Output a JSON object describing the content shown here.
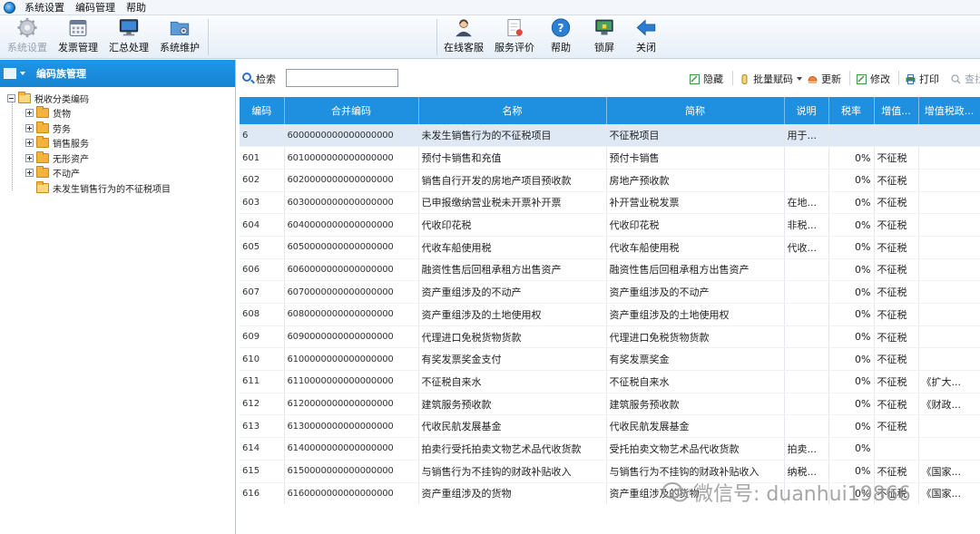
{
  "menubar": {
    "items": [
      "系统设置",
      "编码管理",
      "帮助"
    ]
  },
  "toolbar": {
    "left": [
      {
        "label": "系统设置",
        "icon": "gear-icon",
        "disabled": true
      },
      {
        "label": "发票管理",
        "icon": "calendar-icon",
        "disabled": false
      },
      {
        "label": "汇总处理",
        "icon": "monitor-icon",
        "disabled": false
      },
      {
        "label": "系统维护",
        "icon": "folder-gear-icon",
        "disabled": false
      }
    ],
    "right": [
      {
        "label": "在线客服",
        "icon": "support-agent-icon"
      },
      {
        "label": "服务评价",
        "icon": "evaluation-icon"
      },
      {
        "label": "帮助",
        "icon": "help-icon"
      },
      {
        "label": "锁屏",
        "icon": "lock-screen-icon"
      },
      {
        "label": "关闭",
        "icon": "close-arrow-icon"
      }
    ]
  },
  "left_panel": {
    "title": "编码族管理",
    "tree": {
      "root": "税收分类编码",
      "children": [
        "货物",
        "劳务",
        "销售服务",
        "无形资产",
        "不动产",
        "未发生销售行为的不征税项目"
      ]
    }
  },
  "search": {
    "label": "检索",
    "value": ""
  },
  "actions": [
    {
      "label": "隐藏",
      "icon": "edit-icon",
      "disabled": false
    },
    {
      "label": "批量赋码",
      "icon": "batch-code-icon",
      "disabled": false
    },
    {
      "label": "更新",
      "icon": "update-icon",
      "disabled": false
    },
    {
      "label": "修改",
      "icon": "modify-icon",
      "disabled": false
    },
    {
      "label": "打印",
      "icon": "print-icon",
      "disabled": false
    },
    {
      "label": "查找",
      "icon": "find-icon",
      "disabled": true
    }
  ],
  "grid": {
    "columns": [
      "编码",
      "合并编码",
      "名称",
      "简称",
      "说明",
      "税率",
      "增值...",
      "增值税政..."
    ],
    "rows": [
      [
        "6",
        "6000000000000000000",
        "未发生销售行为的不征税项目",
        "不征税项目",
        "用于...",
        "",
        "",
        ""
      ],
      [
        "601",
        "6010000000000000000",
        "预付卡销售和充值",
        "预付卡销售",
        "",
        "0%",
        "不征税",
        ""
      ],
      [
        "602",
        "6020000000000000000",
        "销售自行开发的房地产项目预收款",
        "房地产预收款",
        "",
        "0%",
        "不征税",
        ""
      ],
      [
        "603",
        "6030000000000000000",
        "已申报缴纳营业税未开票补开票",
        "补开营业税发票",
        "在地...",
        "0%",
        "不征税",
        ""
      ],
      [
        "604",
        "6040000000000000000",
        "代收印花税",
        "代收印花税",
        "非税...",
        "0%",
        "不征税",
        ""
      ],
      [
        "605",
        "6050000000000000000",
        "代收车船使用税",
        "代收车船使用税",
        "代收...",
        "0%",
        "不征税",
        ""
      ],
      [
        "606",
        "6060000000000000000",
        "融资性售后回租承租方出售资产",
        "融资性售后回租承租方出售资产",
        "",
        "0%",
        "不征税",
        ""
      ],
      [
        "607",
        "6070000000000000000",
        "资产重组涉及的不动产",
        "资产重组涉及的不动产",
        "",
        "0%",
        "不征税",
        ""
      ],
      [
        "608",
        "6080000000000000000",
        "资产重组涉及的土地使用权",
        "资产重组涉及的土地使用权",
        "",
        "0%",
        "不征税",
        ""
      ],
      [
        "609",
        "6090000000000000000",
        "代理进口免税货物货款",
        "代理进口免税货物货款",
        "",
        "0%",
        "不征税",
        ""
      ],
      [
        "610",
        "6100000000000000000",
        "有奖发票奖金支付",
        "有奖发票奖金",
        "",
        "0%",
        "不征税",
        ""
      ],
      [
        "611",
        "6110000000000000000",
        "不征税自来水",
        "不征税自来水",
        "",
        "0%",
        "不征税",
        "《扩大..."
      ],
      [
        "612",
        "6120000000000000000",
        "建筑服务预收款",
        "建筑服务预收款",
        "",
        "0%",
        "不征税",
        "《财政..."
      ],
      [
        "613",
        "6130000000000000000",
        "代收民航发展基金",
        "代收民航发展基金",
        "",
        "0%",
        "不征税",
        ""
      ],
      [
        "614",
        "6140000000000000000",
        "拍卖行受托拍卖文物艺术品代收货款",
        "受托拍卖文物艺术品代收货款",
        "拍卖...",
        "0%",
        "",
        ""
      ],
      [
        "615",
        "6150000000000000000",
        "与销售行为不挂钩的财政补贴收入",
        "与销售行为不挂钩的财政补贴收入",
        "纳税...",
        "0%",
        "不征税",
        "《国家..."
      ],
      [
        "616",
        "6160000000000000000",
        "资产重组涉及的货物",
        "资产重组涉及的货物",
        "",
        "0%",
        "不征税",
        "《国家..."
      ]
    ]
  },
  "watermark": {
    "text": "微信号: duanhui19866",
    "icon": "wechat-icon"
  },
  "colors": {
    "header_blue": "#1f8fe0",
    "selected_row": "#dfe9f5"
  }
}
